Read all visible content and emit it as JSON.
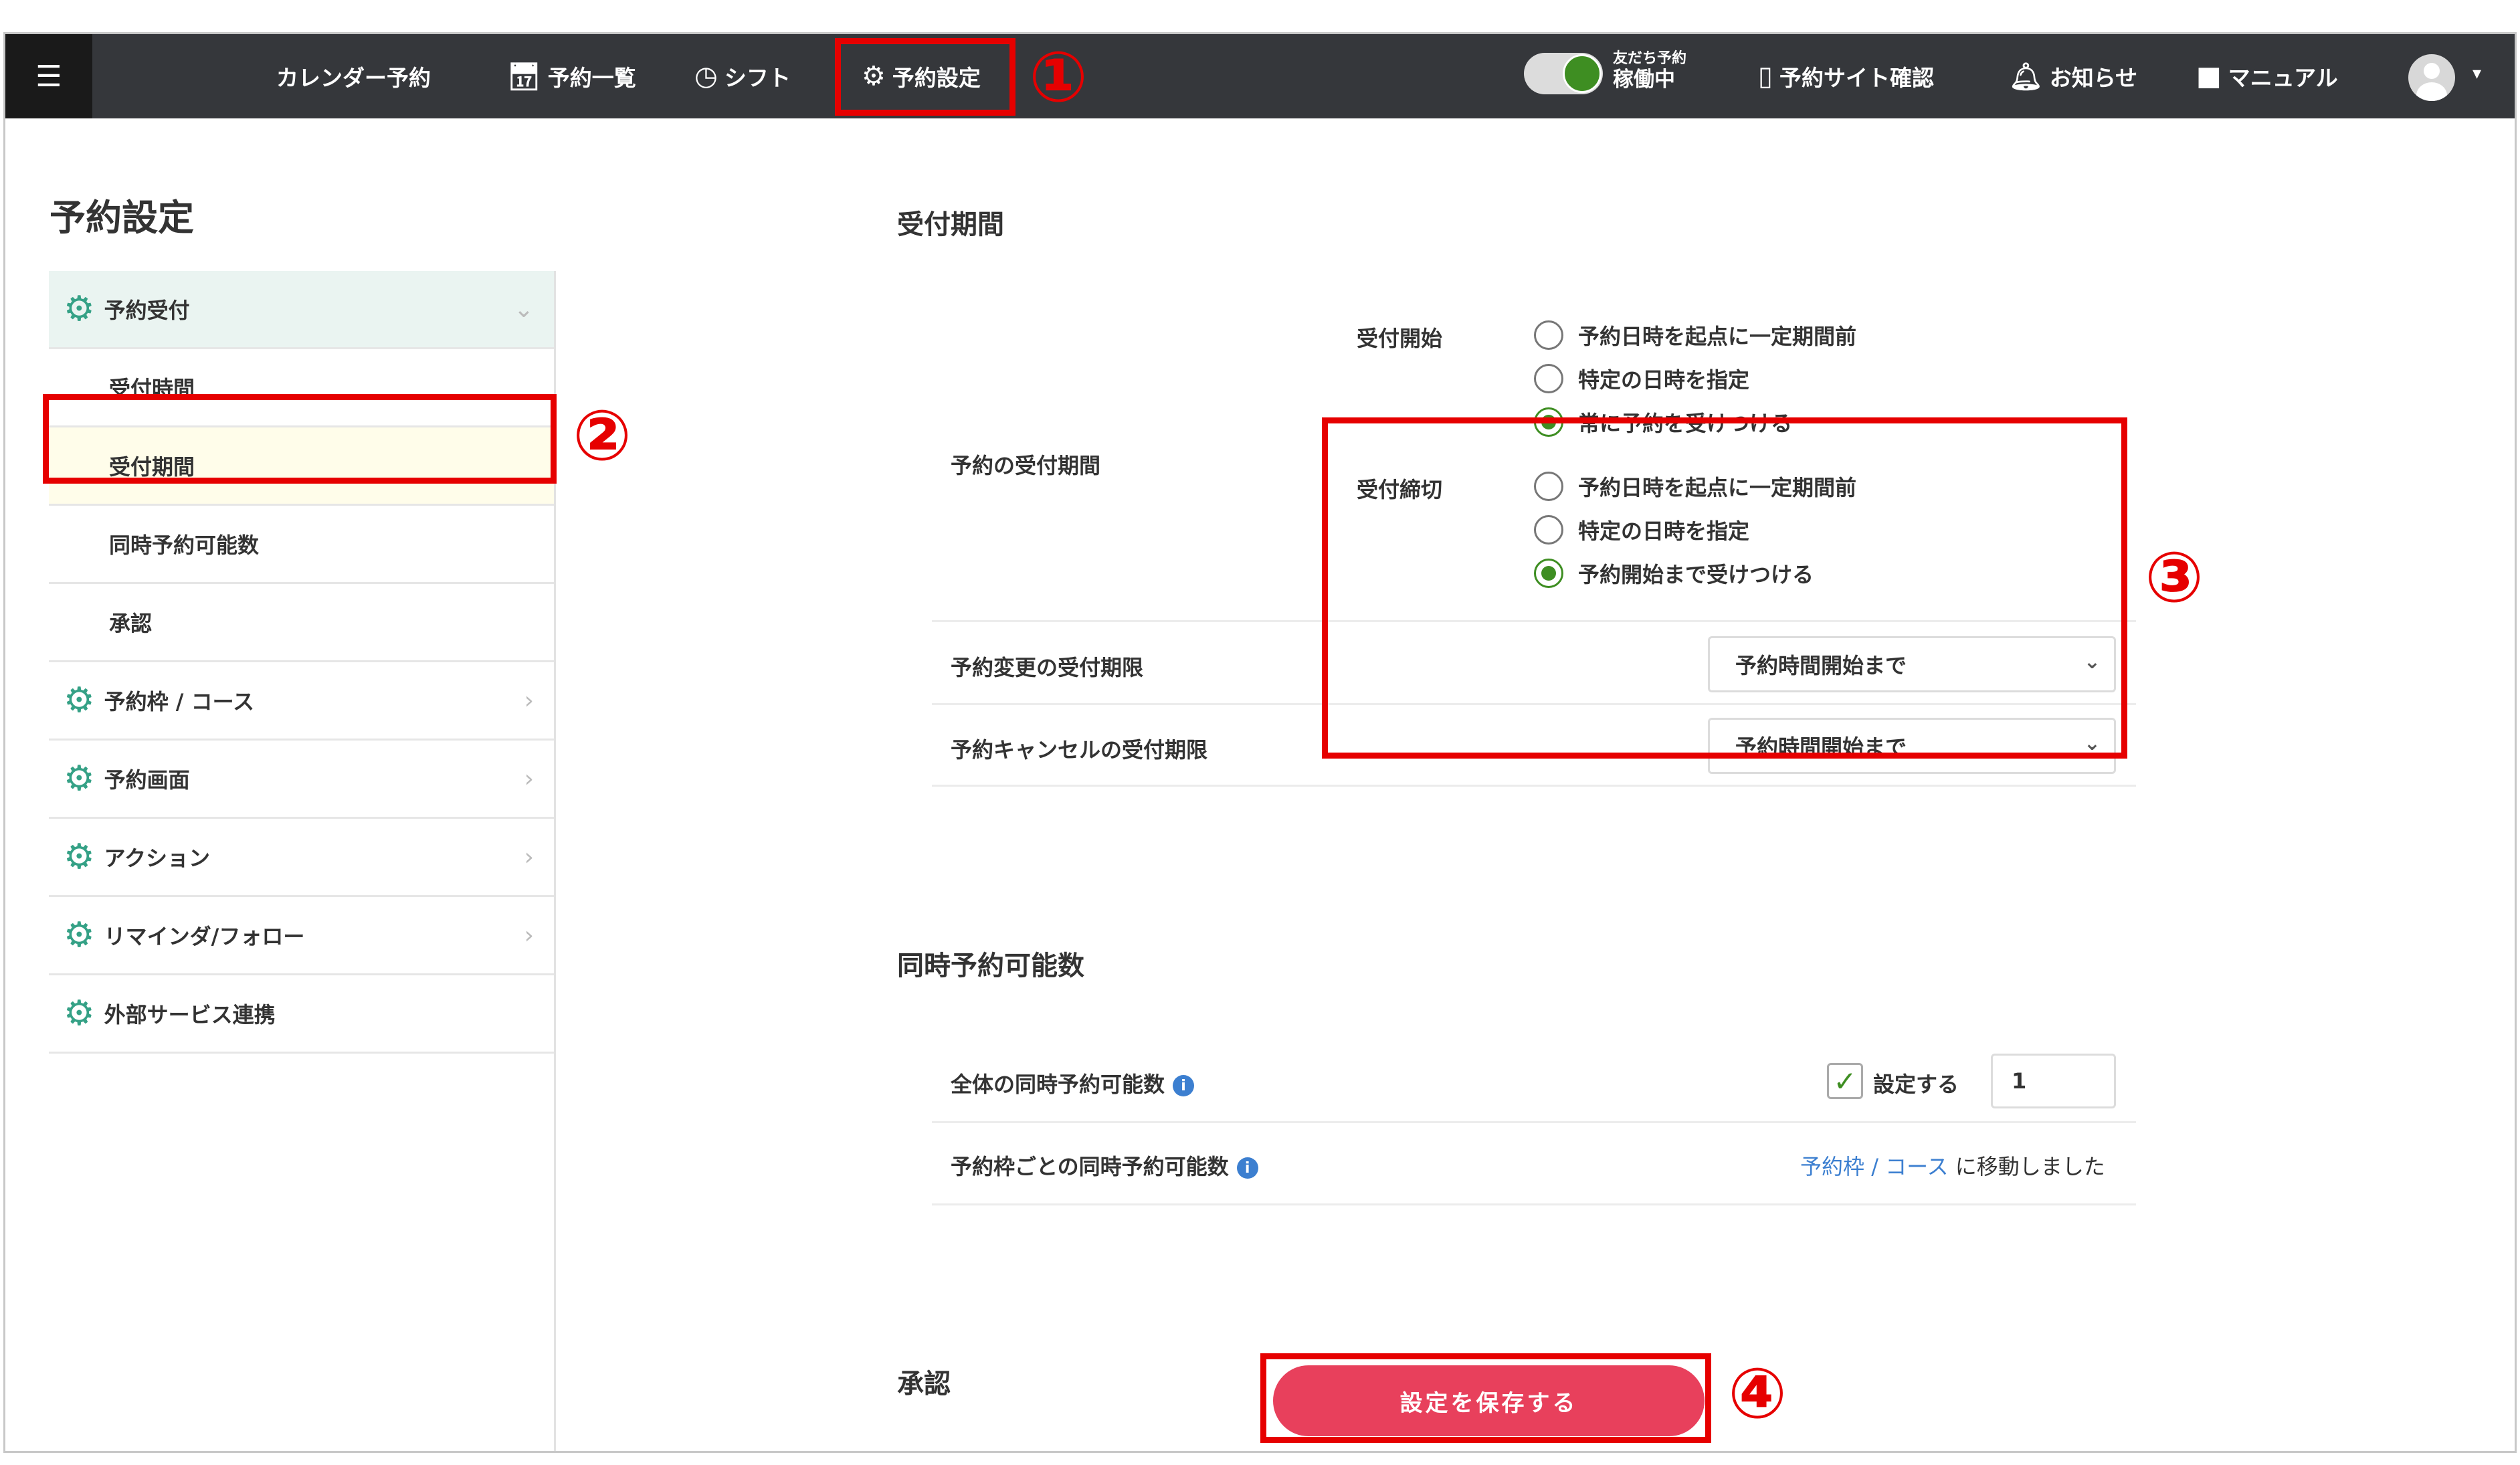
{
  "nav": {
    "menu_icon": "☰",
    "items": [
      {
        "icon": "",
        "label": "カレンダー予約"
      },
      {
        "icon": "calendar-icon",
        "label": "予約一覧"
      },
      {
        "icon": "clock-icon",
        "label": "シフト"
      },
      {
        "icon": "gear-icon",
        "label": "予約設定"
      }
    ],
    "toggle": {
      "small_label": "友だち予約",
      "status": "稼働中",
      "on": true
    },
    "right_items": [
      {
        "icon": "smartphone-icon",
        "label": "予約サイト確認"
      },
      {
        "icon": "bell-icon",
        "label": "お知らせ"
      },
      {
        "icon": "book-icon",
        "label": "マニュアル"
      }
    ]
  },
  "annotations": [
    "①",
    "②",
    "③",
    "④"
  ],
  "sidebar": {
    "title": "予約設定",
    "items": [
      {
        "label": "予約受付",
        "type": "category",
        "expanded": true
      },
      {
        "label": "受付時間",
        "type": "sub"
      },
      {
        "label": "受付期間",
        "type": "sub",
        "selected": true
      },
      {
        "label": "同時予約可能数",
        "type": "sub"
      },
      {
        "label": "承認",
        "type": "sub"
      },
      {
        "label": "予約枠 / コース",
        "type": "category"
      },
      {
        "label": "予約画面",
        "type": "category"
      },
      {
        "label": "アクション",
        "type": "category"
      },
      {
        "label": "リマインダ/フォロー",
        "type": "category"
      },
      {
        "label": "外部サービス連携",
        "type": "category"
      }
    ]
  },
  "period": {
    "title": "受付期間",
    "row_label": "予約の受付期間",
    "start": {
      "label": "受付開始",
      "options": [
        "予約日時を起点に一定期間前",
        "特定の日時を指定",
        "常に予約を受けつける"
      ],
      "selected": 2
    },
    "end": {
      "label": "受付締切",
      "options": [
        "予約日時を起点に一定期間前",
        "特定の日時を指定",
        "予約開始まで受けつける"
      ],
      "selected": 2
    },
    "change_limit": {
      "label": "予約変更の受付期限",
      "value": "予約時間開始まで"
    },
    "cancel_limit": {
      "label": "予約キャンセルの受付期限",
      "value": "予約時間開始まで"
    }
  },
  "concurrent": {
    "title": "同時予約可能数",
    "total": {
      "label": "全体の同時予約可能数",
      "checkbox_label": "設定する",
      "checked": true,
      "value": "1"
    },
    "per_slot": {
      "label": "予約枠ごとの同時予約可能数",
      "link_a": "予約枠",
      "sep": " / ",
      "link_b": "コース",
      "suffix": " に移動しました"
    }
  },
  "approval": {
    "title": "承認"
  },
  "save_button": "設定を保存する",
  "colors": {
    "nav_bg": "#35373b",
    "accent_green": "#3e8e22",
    "sidebar_gear": "#35a186",
    "save_red": "#e8405c",
    "highlight_red": "#e60000",
    "link_blue": "#3c7fd0"
  }
}
